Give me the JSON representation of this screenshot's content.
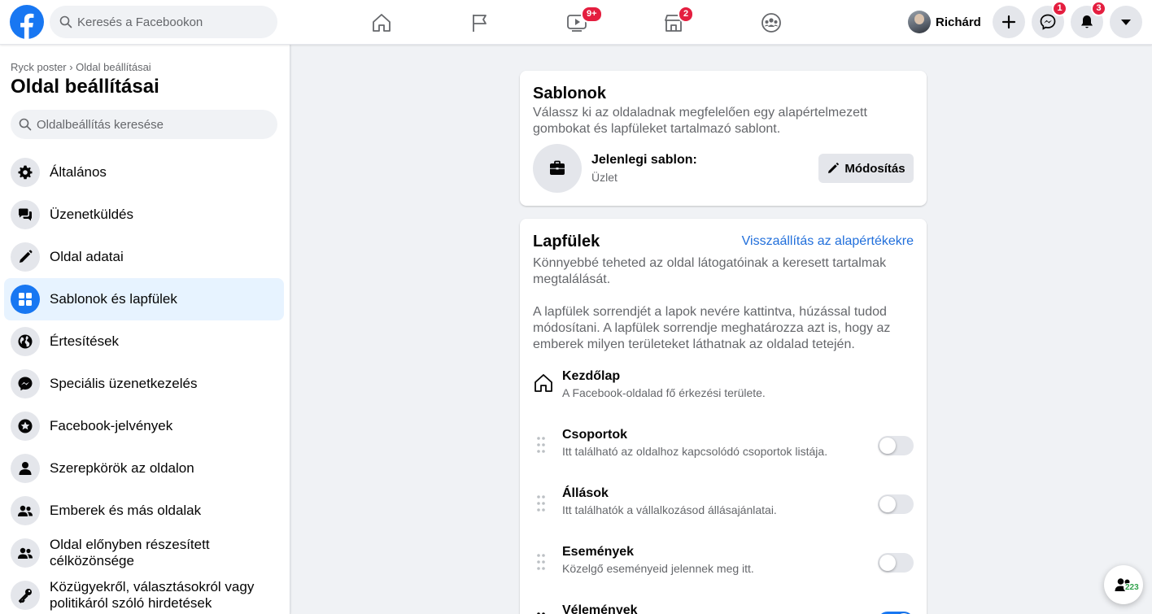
{
  "topbar": {
    "logo_icon": "facebook-logo-icon",
    "search_placeholder": "Keresés a Facebookon",
    "nav": [
      {
        "icon": "home-icon"
      },
      {
        "icon": "flag-icon"
      },
      {
        "icon": "watch-icon",
        "badge": "9+"
      },
      {
        "icon": "marketplace-icon",
        "badge": "2"
      },
      {
        "icon": "groups-icon"
      }
    ],
    "profile_name": "Richárd",
    "buttons": [
      {
        "icon": "plus-icon"
      },
      {
        "icon": "messenger-icon",
        "badge": "1"
      },
      {
        "icon": "bell-icon",
        "badge": "3"
      },
      {
        "icon": "caret-down-icon"
      }
    ]
  },
  "sidebar": {
    "breadcrumb": "Ryck poster › Oldal beállításai",
    "title": "Oldal beállításai",
    "search_placeholder": "Oldalbeállítás keresése",
    "items": [
      {
        "label": "Általános",
        "icon": "gear-icon"
      },
      {
        "label": "Üzenetküldés",
        "icon": "chat-bubbles-icon"
      },
      {
        "label": "Oldal adatai",
        "icon": "pencil-icon"
      },
      {
        "label": "Sablonok és lapfülek",
        "icon": "grid-icon",
        "active": true
      },
      {
        "label": "Értesítések",
        "icon": "globe-icon"
      },
      {
        "label": "Speciális üzenetkezelés",
        "icon": "messenger-icon"
      },
      {
        "label": "Facebook-jelvények",
        "icon": "star-badge-icon"
      },
      {
        "label": "Szerepkörök az oldalon",
        "icon": "person-icon"
      },
      {
        "label": "Emberek és más oldalak",
        "icon": "people-icon"
      },
      {
        "label": "Oldal előnyben részesített célközönsége",
        "icon": "people-icon"
      },
      {
        "label": "Közügyekről, választásokról vagy politikáról szóló hirdetések",
        "icon": "key-icon"
      }
    ]
  },
  "templates_card": {
    "title": "Sablonok",
    "description": "Válassz ki az oldaladnak megfelelően egy alapértelmezett gombokat és lapfüleket tartalmazó sablont.",
    "current_label": "Jelenlegi sablon:",
    "current_value": "Üzlet",
    "edit_button": "Módosítás"
  },
  "tabs_card": {
    "title": "Lapfülek",
    "reset_link": "Visszaállítás az alapértékekre",
    "paragraph1": "Könnyebbé teheted az oldal látogatóinak a keresett tartalmak megtalálását.",
    "paragraph2": "A lapfülek sorrendjét a lapok nevére kattintva, húzással tudod módosítani. A lapfülek sorrendje meghatározza azt is, hogy az emberek milyen területeket láthatnak az oldalad tetején.",
    "tabs": [
      {
        "name": "Kezdőlap",
        "description": "A Facebook-oldalad fő érkezési területe.",
        "fixed": true
      },
      {
        "name": "Csoportok",
        "description": "Itt található az oldalhoz kapcsolódó csoportok listája.",
        "enabled": false
      },
      {
        "name": "Állások",
        "description": "Itt találhatók a vállalkozásod állásajánlatai.",
        "enabled": false
      },
      {
        "name": "Események",
        "description": "Közelgő eseményeid jelennek meg itt.",
        "enabled": false
      },
      {
        "name": "Vélemények",
        "description": "",
        "enabled": true
      }
    ]
  },
  "floating": {
    "icon": "people-icon",
    "count": "223"
  }
}
